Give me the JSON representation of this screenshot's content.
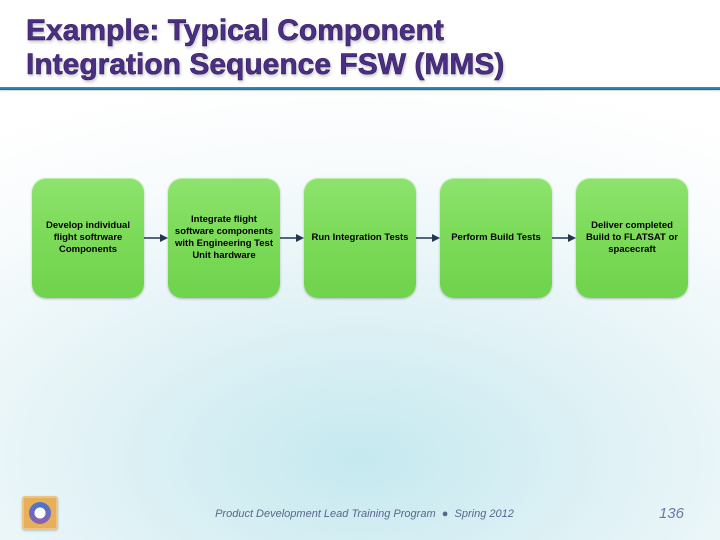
{
  "title": {
    "line1": "Example:  Typical Component",
    "line2": "Integration Sequence FSW (MMS)"
  },
  "flow": {
    "steps": [
      {
        "label": "Develop individual flight softrware Components"
      },
      {
        "label": "Integrate flight software components with Engineering Test Unit hardware"
      },
      {
        "label": "Run Integration Tests"
      },
      {
        "label": "Perform Build Tests"
      },
      {
        "label": "Deliver completed Build to FLATSAT or spacecraft"
      }
    ]
  },
  "footer": {
    "text_left": "Product Development Lead Training Program",
    "bullet": "●",
    "text_right": "Spring 2012",
    "page": "136"
  }
}
